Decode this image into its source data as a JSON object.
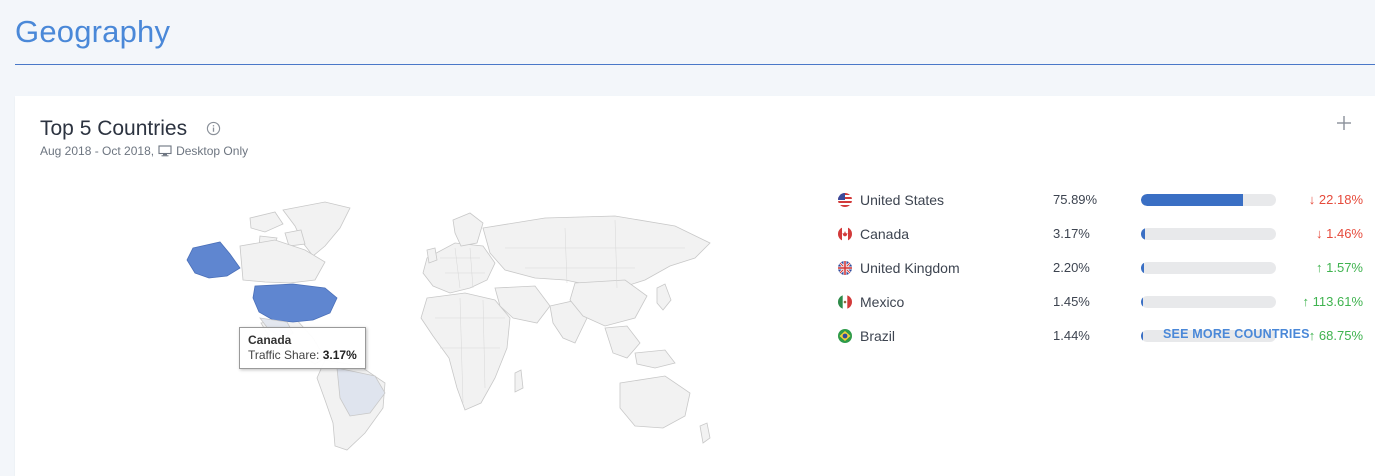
{
  "page": {
    "title": "Geography"
  },
  "card": {
    "title": "Top 5 Countries",
    "subtitle_range": "Aug 2018 - Oct 2018,",
    "subtitle_device": "Desktop Only"
  },
  "tooltip": {
    "country": "Canada",
    "label": "Traffic Share:",
    "value": "3.17%"
  },
  "countries": [
    {
      "name": "United States",
      "share": "75.89%",
      "share_value": 75.89,
      "change": "22.18%",
      "direction": "down",
      "flag": "us-flag-icon"
    },
    {
      "name": "Canada",
      "share": "3.17%",
      "share_value": 3.17,
      "change": "1.46%",
      "direction": "down",
      "flag": "canada-flag-icon"
    },
    {
      "name": "United Kingdom",
      "share": "2.20%",
      "share_value": 2.2,
      "change": "1.57%",
      "direction": "up",
      "flag": "uk-flag-icon"
    },
    {
      "name": "Mexico",
      "share": "1.45%",
      "share_value": 1.45,
      "change": "113.61%",
      "direction": "up",
      "flag": "mexico-flag-icon"
    },
    {
      "name": "Brazil",
      "share": "1.44%",
      "share_value": 1.44,
      "change": "68.75%",
      "direction": "up",
      "flag": "brazil-flag-icon"
    }
  ],
  "see_more_label": "SEE MORE COUNTRIES",
  "colors": {
    "accent": "#4a88d8",
    "bar": "#3a6fc4",
    "highlight_country": "#5f86d0",
    "down": "#e64b3c",
    "up": "#3fb34f"
  }
}
